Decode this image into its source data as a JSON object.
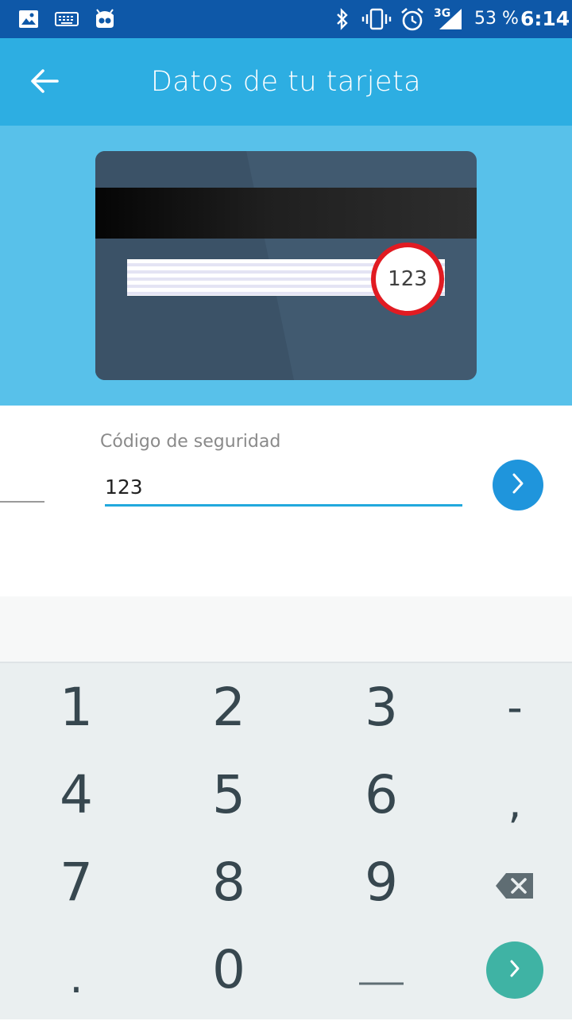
{
  "status_bar": {
    "icons": [
      "gallery-icon",
      "keyboard-icon",
      "cyanogen-icon",
      "bluetooth-icon",
      "vibrate-icon",
      "alarm-icon",
      "signal-3g-icon"
    ],
    "network": "3G",
    "battery": "53 %",
    "time": "6:14"
  },
  "app_bar": {
    "title": "Datos de tu tarjeta",
    "back_icon": "arrow-left-icon"
  },
  "card": {
    "cvv_example": "123",
    "highlight_color": "#e11b22"
  },
  "form": {
    "label": "Código de seguridad",
    "value": "123",
    "next_icon": "chevron-right-icon"
  },
  "keyboard": {
    "keys": [
      "1",
      "2",
      "3",
      "-",
      "4",
      "5",
      "6",
      ",",
      "7",
      "8",
      "9",
      "⌫",
      ".",
      "0",
      "_",
      "›"
    ]
  },
  "colors": {
    "status_bar": "#0e58a8",
    "app_bar": "#2daee2",
    "hero": "#58c1ea",
    "accent": "#1f95dc",
    "keyboard_go": "#3fb3a4"
  }
}
